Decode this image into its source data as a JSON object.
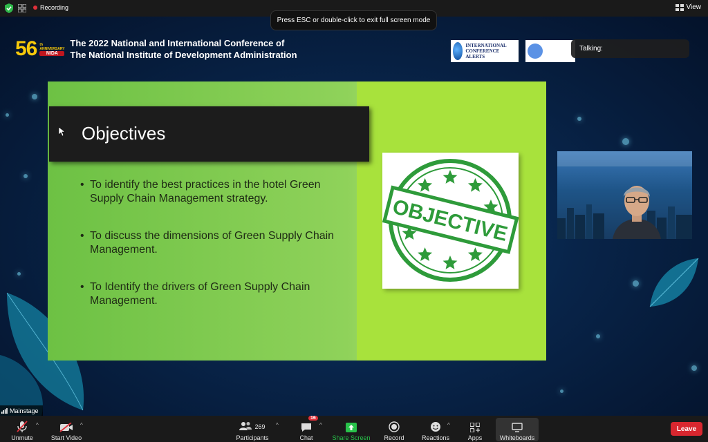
{
  "status_bar": {
    "recording_label": "Recording",
    "view_label": "View"
  },
  "toast": {
    "fullscreen_hint": "Press ESC or double-click to exit full screen mode"
  },
  "conference": {
    "anniversary_number": "56",
    "anniversary_sup": "th",
    "anniversary_word": "ANNIVERSARY",
    "org_short": "NIDA",
    "title_line1": "The 2022 National and International Conference of",
    "title_line2": "The National Institute of Development Administration",
    "partner1_name": "INTERNATIONAL CONFERENCE ALERTS"
  },
  "talking": {
    "label": "Talking:"
  },
  "slide": {
    "title": "Objectives",
    "bullets": [
      "To identify the best practices in the hotel Green Supply Chain Management strategy.",
      "To discuss the dimensions of Green Supply Chain Management.",
      "To  Identify the drivers of Green Supply Chain Management."
    ],
    "stamp_text": "OBJECTIVE",
    "colors": {
      "green_gradient_start": "#6dc144",
      "lime_panel": "#a8e23c",
      "stamp_green": "#2e9b3a"
    }
  },
  "mainstage": {
    "label": "Mainstage"
  },
  "toolbar": {
    "unmute": "Unmute",
    "start_video": "Start Video",
    "participants": "Participants",
    "participants_count": "269",
    "chat": "Chat",
    "chat_badge": "16",
    "share_screen": "Share Screen",
    "record": "Record",
    "reactions": "Reactions",
    "apps": "Apps",
    "whiteboards": "Whiteboards",
    "leave": "Leave",
    "colors": {
      "leave_red": "#d8272f",
      "share_green": "#28c24a"
    }
  }
}
